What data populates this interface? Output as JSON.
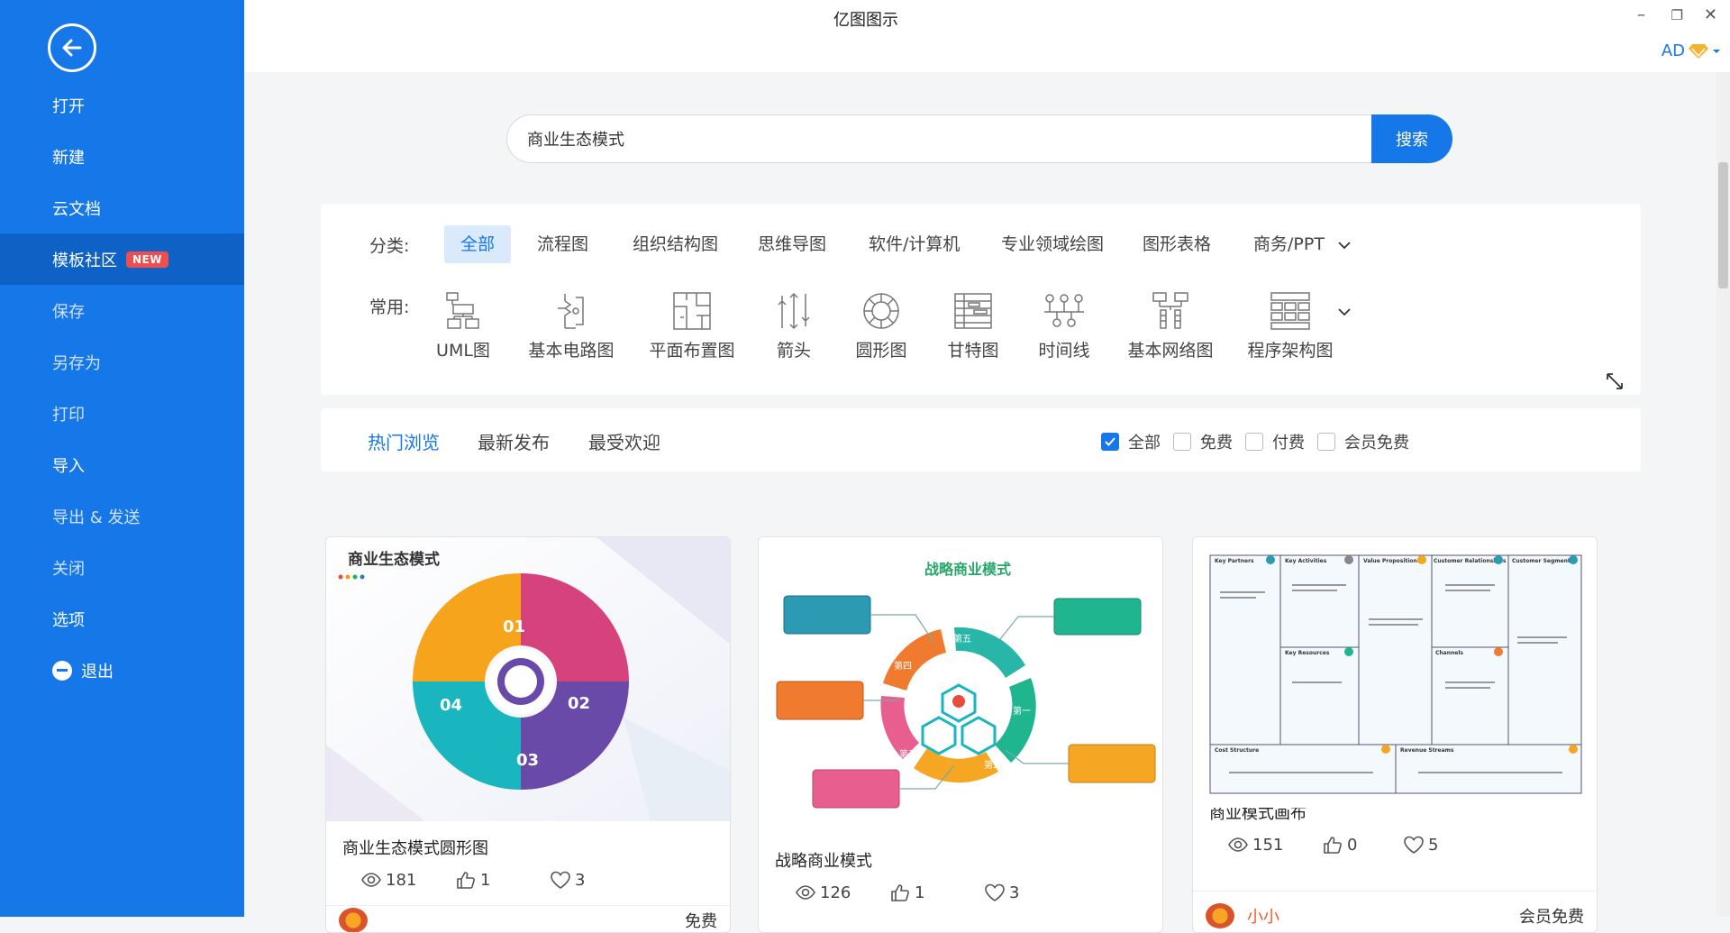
{
  "window": {
    "title": "亿图图示",
    "user_initials": "AD"
  },
  "sidebar": {
    "items": [
      {
        "label": "打开"
      },
      {
        "label": "新建"
      },
      {
        "label": "云文档"
      },
      {
        "label": "模板社区",
        "badge": "NEW"
      },
      {
        "label": "保存"
      },
      {
        "label": "另存为"
      },
      {
        "label": "打印"
      },
      {
        "label": "导入"
      },
      {
        "label": "导出 & 发送"
      },
      {
        "label": "关闭"
      },
      {
        "label": "选项"
      },
      {
        "label": "退出"
      }
    ]
  },
  "search": {
    "value": "商业生态模式",
    "button": "搜索"
  },
  "categories": {
    "label": "分类:",
    "items": [
      "全部",
      "流程图",
      "组织结构图",
      "思维导图",
      "软件/计算机",
      "专业领域绘图",
      "图形表格",
      "商务/PPT"
    ]
  },
  "common": {
    "label": "常用:",
    "items": [
      "UML图",
      "基本电路图",
      "平面布置图",
      "箭头",
      "圆形图",
      "甘特图",
      "时间线",
      "基本网络图",
      "程序架构图"
    ]
  },
  "tabs": [
    "热门浏览",
    "最新发布",
    "最受欢迎"
  ],
  "filters": [
    {
      "label": "全部",
      "checked": true
    },
    {
      "label": "免费",
      "checked": false
    },
    {
      "label": "付费",
      "checked": false
    },
    {
      "label": "会员免费",
      "checked": false
    }
  ],
  "cards": [
    {
      "thumb_title": "商业生态模式",
      "title": "商业生态模式圆形图",
      "views": "181",
      "likes": "1",
      "favorites": "3",
      "price": "免费",
      "segments": [
        "01",
        "02",
        "03",
        "04"
      ]
    },
    {
      "thumb_title": "战略商业模式",
      "title": "战略商业模式",
      "views": "126",
      "likes": "1",
      "favorites": "3",
      "segments": [
        "第一",
        "第二",
        "第三",
        "第四",
        "第五"
      ]
    },
    {
      "title": "商业模式画布",
      "views": "151",
      "likes": "0",
      "favorites": "5",
      "author": "小小",
      "price": "会员免费",
      "canvas_headers": [
        "Key Partners",
        "Key Activities",
        "Value Propositions",
        "Customer Relationships",
        "Customer Segments",
        "Key Resources",
        "Channels",
        "Cost Structure",
        "Revenue Streams"
      ]
    }
  ],
  "colors": {
    "accent": "#1677e8",
    "sidebar_active": "#0f62c5",
    "badge": "#f04d4d"
  }
}
